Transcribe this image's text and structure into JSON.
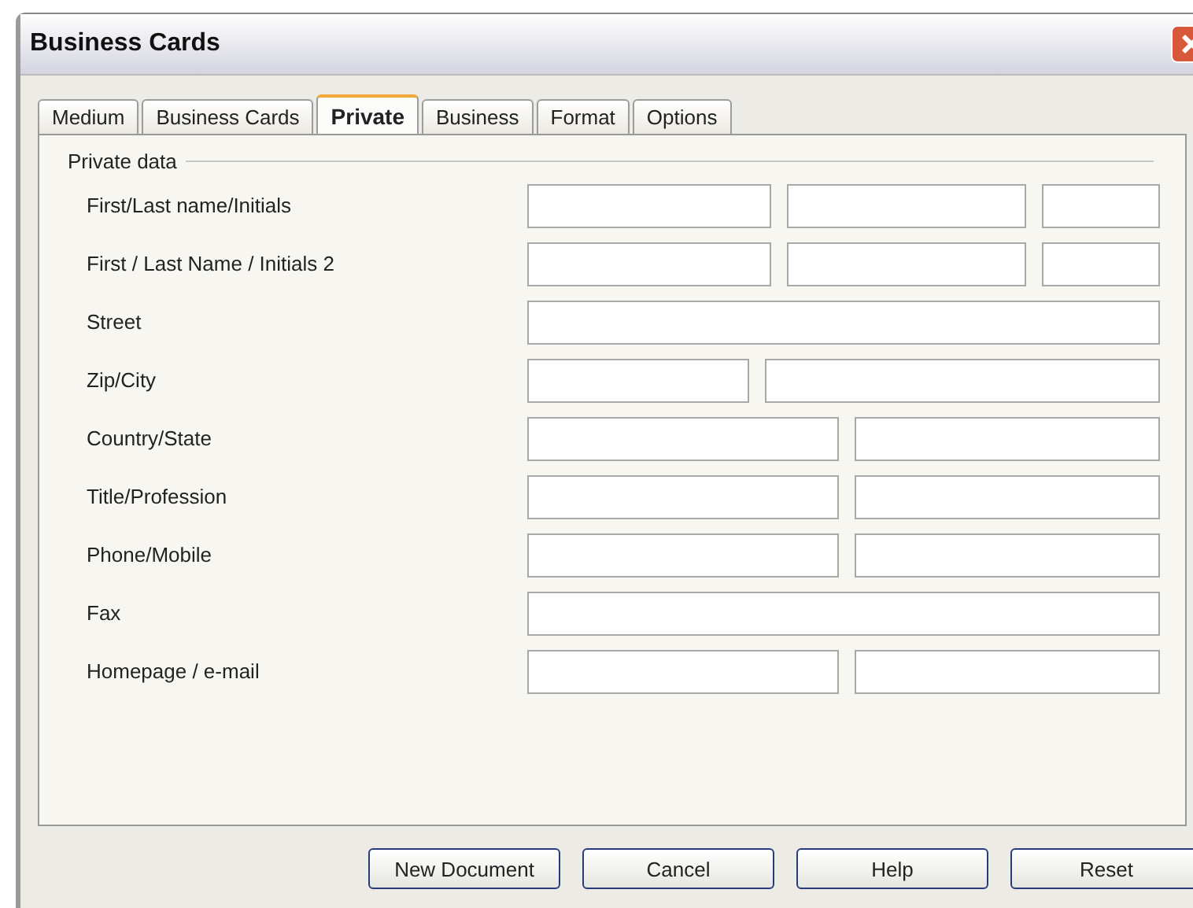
{
  "window": {
    "title": "Business Cards"
  },
  "tabs": [
    {
      "label": "Medium",
      "selected": false
    },
    {
      "label": "Business Cards",
      "selected": false
    },
    {
      "label": "Private",
      "selected": true
    },
    {
      "label": "Business",
      "selected": false
    },
    {
      "label": "Format",
      "selected": false
    },
    {
      "label": "Options",
      "selected": false
    }
  ],
  "group": {
    "title": "Private data"
  },
  "rows": [
    {
      "label": "First/Last name/Initials",
      "kind": "triple"
    },
    {
      "label": "First / Last Name / Initials 2",
      "kind": "triple"
    },
    {
      "label": "Street",
      "kind": "single"
    },
    {
      "label": "Zip/City",
      "kind": "zip"
    },
    {
      "label": "Country/State",
      "kind": "pair"
    },
    {
      "label": "Title/Profession",
      "kind": "pair"
    },
    {
      "label": "Phone/Mobile",
      "kind": "pair"
    },
    {
      "label": "Fax",
      "kind": "single"
    },
    {
      "label": "Homepage / e-mail",
      "kind": "pair"
    }
  ],
  "buttons": [
    "New Document",
    "Cancel",
    "Help",
    "Reset"
  ]
}
